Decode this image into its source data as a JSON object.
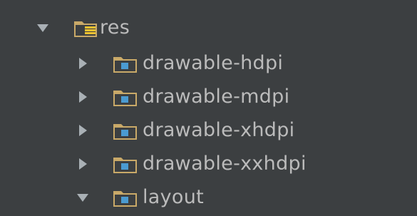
{
  "tree": {
    "root": {
      "label": "res",
      "expanded": true,
      "icon": "resource-folder-icon"
    },
    "children": [
      {
        "label": "drawable-hdpi",
        "expanded": false,
        "icon": "folder-icon"
      },
      {
        "label": "drawable-mdpi",
        "expanded": false,
        "icon": "folder-icon"
      },
      {
        "label": "drawable-xhdpi",
        "expanded": false,
        "icon": "folder-icon"
      },
      {
        "label": "drawable-xxhdpi",
        "expanded": false,
        "icon": "folder-icon"
      },
      {
        "label": "layout",
        "expanded": true,
        "icon": "folder-icon"
      }
    ]
  },
  "colors": {
    "background": "#3c3f41",
    "text": "#bbbbbb",
    "arrow": "#a9b0b5",
    "folder": "#c9a968",
    "folder_dark": "#a88848",
    "folder_badge": "#4b9bd1",
    "res_stripes": "#f2c230"
  }
}
